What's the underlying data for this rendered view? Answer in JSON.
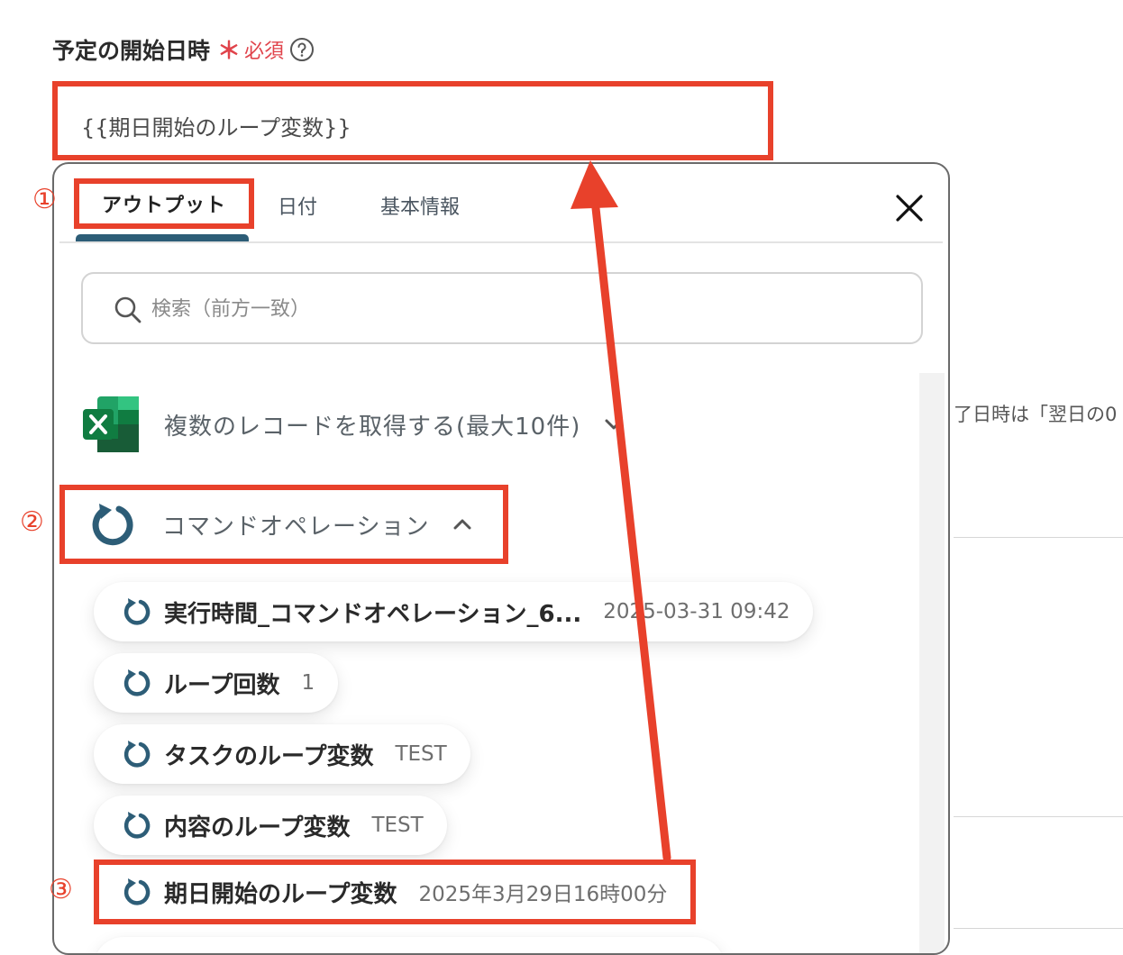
{
  "field": {
    "label": "予定の開始日時",
    "required_mark": "＊",
    "required_text": "必須",
    "value": "{{期日開始のループ変数}}"
  },
  "background": {
    "note_fragment": "了日時は「翌日の0"
  },
  "panel": {
    "tabs": [
      {
        "label": "アウトプット",
        "active": true
      },
      {
        "label": "日付",
        "active": false
      },
      {
        "label": "基本情報",
        "active": false
      }
    ],
    "search": {
      "placeholder": "検索（前方一致）"
    },
    "groups": [
      {
        "title": "複数のレコードを取得する(最大10件)",
        "expanded": false,
        "icon": "excel-icon"
      },
      {
        "title": "コマンドオペレーション",
        "expanded": true,
        "icon": "loop-icon"
      }
    ],
    "items": [
      {
        "name": "実行時間_コマンドオペレーション_6...",
        "value": "2025-03-31 09:42"
      },
      {
        "name": "ループ回数",
        "value": "1"
      },
      {
        "name": "タスクのループ変数",
        "value": "TEST"
      },
      {
        "name": "内容のループ変数",
        "value": "TEST"
      },
      {
        "name": "期日開始のループ変数",
        "value": "2025年3月29日16時00分"
      }
    ]
  },
  "annotations": {
    "step1": "①",
    "step2": "②",
    "step3": "③"
  },
  "colors": {
    "highlight": "#e8412b",
    "accent": "#2d5d77",
    "required": "#e0434b"
  }
}
